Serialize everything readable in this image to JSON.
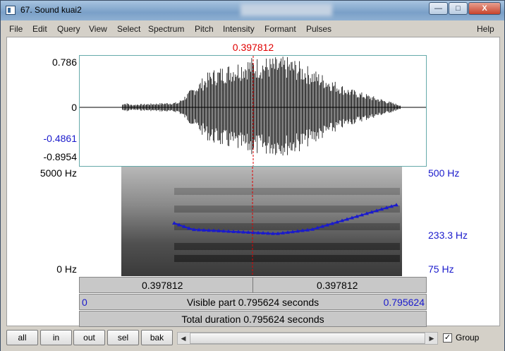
{
  "window": {
    "title": "67. Sound kuai2",
    "min_label": "—",
    "max_label": "□",
    "close_label": "X"
  },
  "menu": [
    "File",
    "Edit",
    "Query",
    "View",
    "Select",
    "Spectrum",
    "Pitch",
    "Intensity",
    "Formant",
    "Pulses",
    "Help"
  ],
  "cursor_time": "0.397812",
  "waveform": {
    "y_top": "0.786",
    "y_zero": "0",
    "y_sel": "-0.4861",
    "y_bottom": "-0.8954"
  },
  "spectrogram": {
    "freq_top": "5000 Hz",
    "freq_bottom": "0 Hz",
    "pitch_top": "500 Hz",
    "pitch_mid": "233.3 Hz",
    "pitch_bottom": "75 Hz"
  },
  "bars": {
    "left_time": "0.397812",
    "right_time": "0.397812",
    "visible_start": "0",
    "visible_text": "Visible part 0.795624 seconds",
    "visible_end": "0.795624",
    "total_text": "Total duration 0.795624 seconds"
  },
  "bottom": {
    "buttons": [
      "all",
      "in",
      "out",
      "sel",
      "bak"
    ],
    "group_label": "Group",
    "group_checked": true,
    "check_mark": "✓",
    "scroll_left": "◀",
    "scroll_right": "▶"
  },
  "colors": {
    "cursor": "#e00000",
    "pitch": "#1a1acc",
    "selection_labels": "#1a1acc"
  }
}
